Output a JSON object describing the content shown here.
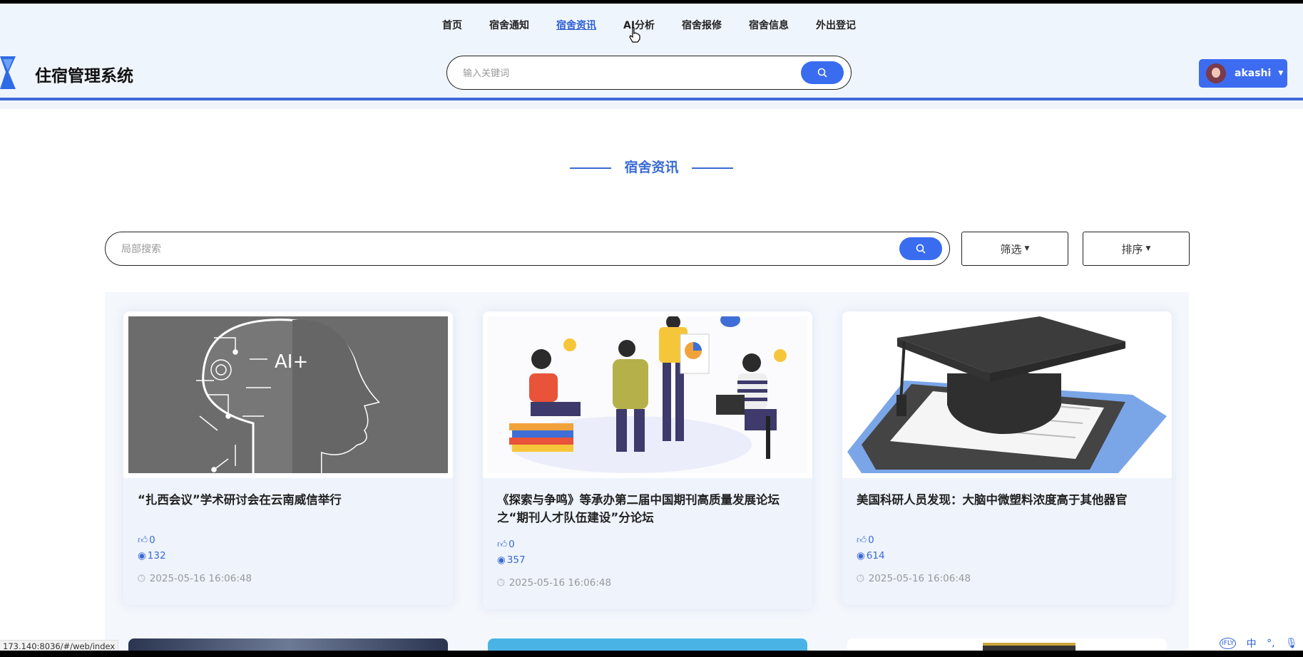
{
  "app": {
    "title": "住宿管理系统",
    "nav": [
      "首页",
      "宿舍通知",
      "宿舍资讯",
      "AI分析",
      "宿舍报修",
      "宿舍信息",
      "外出登记"
    ],
    "active_nav": "宿舍资讯",
    "search_placeholder": "输入关键词",
    "user": "akashi"
  },
  "section": {
    "title": "宿舍资讯"
  },
  "filters": {
    "search_placeholder": "局部搜索",
    "filter_label": "筛选",
    "sort_label": "排序"
  },
  "cards": [
    {
      "title": "“扎西会议”学术研讨会在云南威信举行",
      "likes": "0",
      "views": "132",
      "date": "2025-05-16 16:06:48",
      "image_icon": "ai-head-illustration"
    },
    {
      "title": "《探索与争鸣》等承办第二届中国期刊高质量发展论坛之“期刊人才队伍建设”分论坛",
      "likes": "0",
      "views": "357",
      "date": "2025-05-16 16:06:48",
      "image_icon": "team-discussion-illustration"
    },
    {
      "title": "美国科研人员发现：大脑中微塑料浓度高于其他器官",
      "likes": "0",
      "views": "614",
      "date": "2025-05-16 16:06:48",
      "image_icon": "graduation-cap-illustration"
    }
  ],
  "status_url": "173.140:8036/#/web/index",
  "ime": {
    "brand": "iFLY",
    "lang": "中"
  },
  "colors": {
    "accent": "#3a6cf0",
    "title_blue": "#3a6bd4",
    "header_bg": "#eff5fd"
  }
}
